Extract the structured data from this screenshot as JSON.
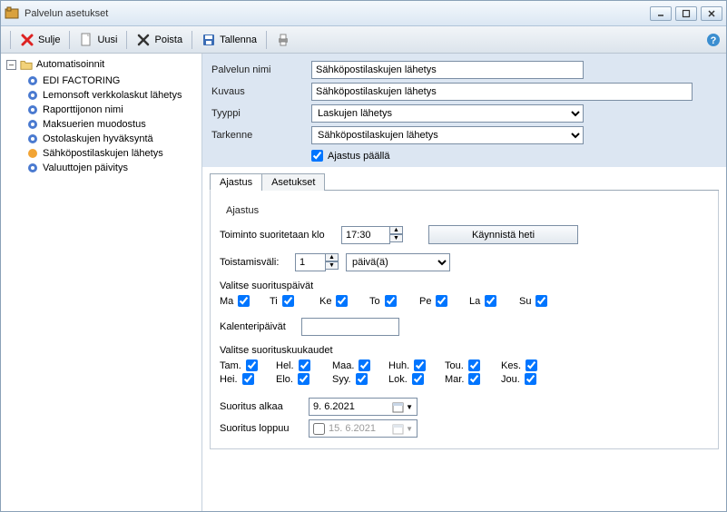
{
  "window": {
    "title": "Palvelun asetukset"
  },
  "toolbar": {
    "close_label": "Sulje",
    "new_label": "Uusi",
    "delete_label": "Poista",
    "save_label": "Tallenna"
  },
  "tree": {
    "root": "Automatisoinnit",
    "items": [
      "EDI FACTORING",
      "Lemonsoft verkkolaskut lähetys",
      "Raporttijonon nimi",
      "Maksuerien muodostus",
      "Ostolaskujen hyväksyntä",
      "Sähköpostilaskujen lähetys",
      "Valuuttojen päivitys"
    ],
    "selected_index": 5
  },
  "form": {
    "name_label": "Palvelun nimi",
    "name_value": "Sähköpostilaskujen lähetys",
    "desc_label": "Kuvaus",
    "desc_value": "Sähköpostilaskujen lähetys",
    "type_label": "Tyyppi",
    "type_value": "Laskujen lähetys",
    "spec_label": "Tarkenne",
    "spec_value": "Sähköpostilaskujen lähetys",
    "enabled_label": "Ajastus päällä"
  },
  "tabs": {
    "t1": "Ajastus",
    "t2": "Asetukset"
  },
  "schedule": {
    "group_title": "Ajastus",
    "run_at_label": "Toiminto suoritetaan klo",
    "run_at_value": "17:30",
    "run_now_label": "Käynnistä heti",
    "interval_label": "Toistamisväli:",
    "interval_value": "1",
    "interval_unit": "päivä(ä)",
    "days_title": "Valitse suorituspäivät",
    "days": [
      "Ma",
      "Ti",
      "Ke",
      "To",
      "Pe",
      "La",
      "Su"
    ],
    "calendar_days_label": "Kalenteripäivät",
    "calendar_days_value": "",
    "months_title": "Valitse suorituskuukaudet",
    "months_row1": [
      "Tam.",
      "Hel.",
      "Maa.",
      "Huh.",
      "Tou.",
      "Kes."
    ],
    "months_row2": [
      "Hei.",
      "Elo.",
      "Syy.",
      "Lok.",
      "Mar.",
      "Jou."
    ],
    "start_label": "Suoritus alkaa",
    "start_value": "9.  6.2021",
    "end_label": "Suoritus loppuu",
    "end_value": "15.  6.2021"
  }
}
